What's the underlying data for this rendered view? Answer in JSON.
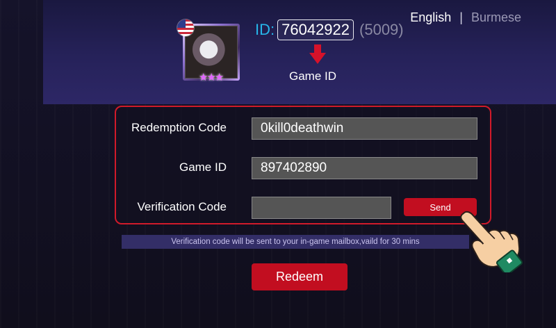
{
  "header": {
    "languages": {
      "active": "English",
      "separator": "|",
      "inactive": "Burmese"
    },
    "player": {
      "id_label": "ID:",
      "id_value": "76042922",
      "zone": "(5009)",
      "flag_icon": "us-flag-icon",
      "avatar_icon": "hero-avatar-icon",
      "stars": "★★★"
    },
    "arrow_icon": "red-down-arrow-icon",
    "caption": "Game ID"
  },
  "form": {
    "redemption_code": {
      "label": "Redemption Code",
      "value": "0kill0deathwin"
    },
    "game_id": {
      "label": "Game ID",
      "value": "897402890"
    },
    "verification_code": {
      "label": "Verification Code",
      "value": ""
    },
    "send_label": "Send"
  },
  "notice": "Verification code will be sent to your in-game mailbox,vaild for 30 mins",
  "redeem_label": "Redeem",
  "decor": {
    "pointer_icon": "pointing-hand-icon"
  },
  "colors": {
    "accent_red": "#c20e20",
    "id_blue": "#27b6ea",
    "notice_bg": "#332e67"
  }
}
